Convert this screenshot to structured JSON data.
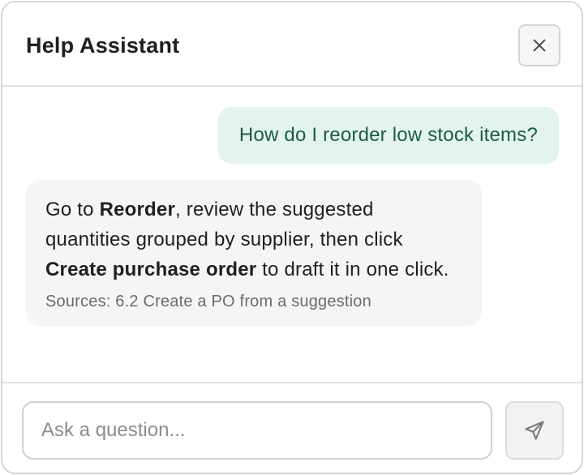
{
  "header": {
    "title": "Help Assistant",
    "close_icon": "close-icon"
  },
  "messages": {
    "user": {
      "text": "How do I reorder low stock items?"
    },
    "assistant": {
      "text_1": "Go to ",
      "bold_1": "Reorder",
      "text_2": ", review the suggested quantities grouped by supplier, then click ",
      "bold_2": "Create purchase order",
      "text_3": " to draft it in one click.",
      "sources": "Sources: 6.2 Create a PO from a suggestion"
    }
  },
  "composer": {
    "placeholder": "Ask a question...",
    "value": "",
    "send_icon": "send-icon"
  },
  "colors": {
    "user_bubble": "#e3f4ec",
    "user_text": "#1f5a44",
    "assistant_bubble": "#f5f5f4"
  }
}
